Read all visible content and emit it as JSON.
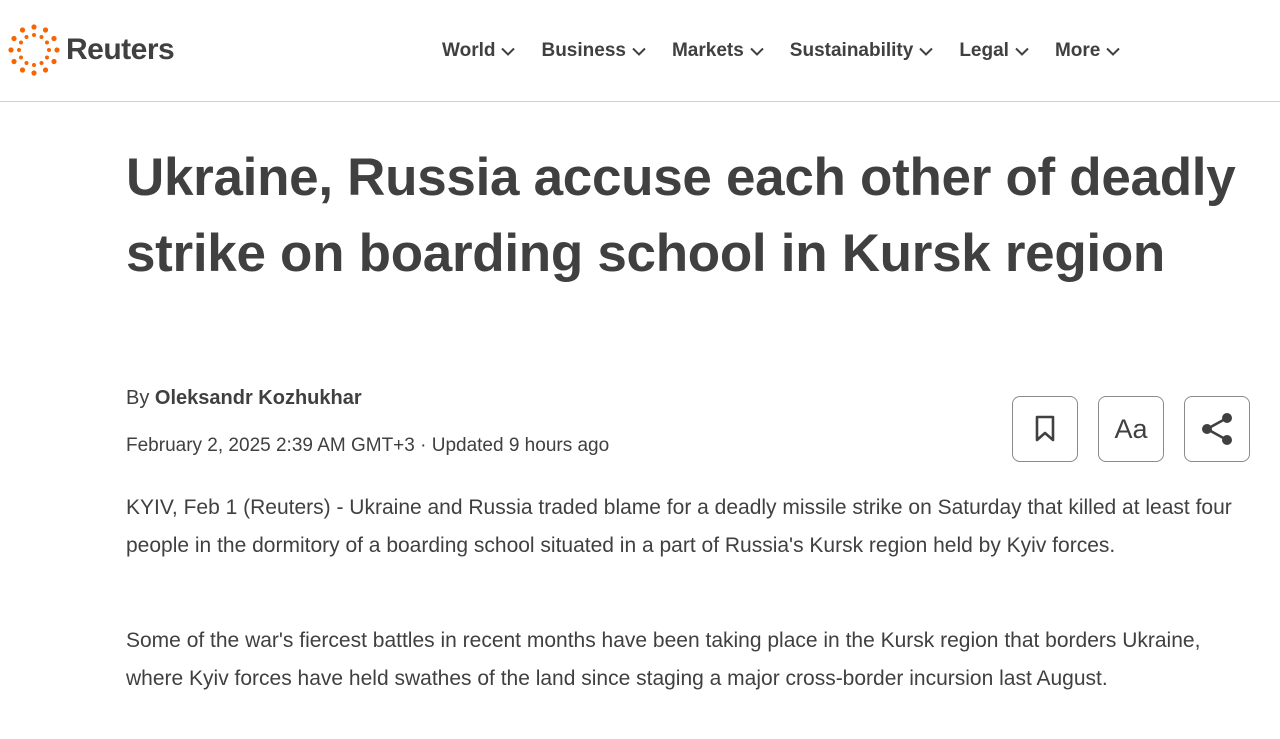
{
  "brand": {
    "name": "Reuters",
    "accent": "#fa6400"
  },
  "nav": {
    "items": [
      {
        "label": "World"
      },
      {
        "label": "Business"
      },
      {
        "label": "Markets"
      },
      {
        "label": "Sustainability"
      },
      {
        "label": "Legal"
      },
      {
        "label": "More"
      }
    ]
  },
  "article": {
    "headline": "Ukraine, Russia accuse each other of deadly strike on boarding school in Kursk region",
    "byline_prefix": "By ",
    "author": "Oleksandr Kozhukhar",
    "dateline": "February 2, 2025 2:39 AM GMT+3 · Updated 9 hours ago",
    "paragraphs": [
      "KYIV, Feb 1 (Reuters) - Ukraine and Russia traded blame for a deadly missile strike on Saturday that killed at least four people in the dormitory of a boarding school situated in a part of Russia's Kursk region held by Kyiv forces.",
      "Some of the war's fiercest battles in recent months have been taking place in the Kursk region that borders Ukraine, where Kyiv forces have held swathes of the land since staging a major cross-border incursion last August."
    ]
  },
  "tools": {
    "bookmark_icon": "bookmark-icon",
    "text_size_label": "Aa",
    "share_icon": "share-icon"
  }
}
